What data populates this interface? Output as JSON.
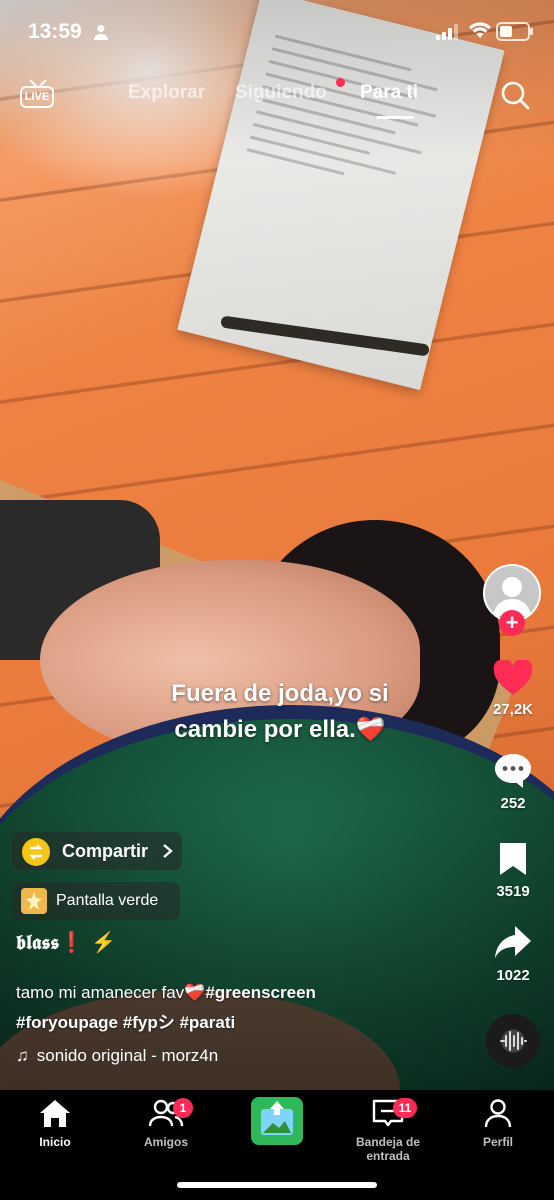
{
  "status_bar": {
    "time": "13:59"
  },
  "top_nav": {
    "live_label": "LIVE",
    "tabs": [
      {
        "label": "Explorar"
      },
      {
        "label": "Siguiendo"
      },
      {
        "label": "Para ti"
      }
    ]
  },
  "video": {
    "caption_line1": "Fuera de joda,yo si",
    "caption_line2": "cambie por ella.❤️‍🩹"
  },
  "actions": {
    "likes": "27,2K",
    "comments": "252",
    "saves": "3519",
    "shares": "1022"
  },
  "info": {
    "share_label": "Compartir",
    "effect_label": "Pantalla verde",
    "username": "𝖇𝖑𝖆𝖘𝖘❗️ ⚡️",
    "description_text": "tamo mi amanecer fav❤️‍🩹",
    "hashtag1": "#greenscreen",
    "hashtag2": "#foryoupage",
    "hashtag3": "#fypシ",
    "hashtag4": "#parati",
    "sound": "sonido original - morz4n"
  },
  "tab_bar": {
    "items": [
      {
        "label": "Inicio"
      },
      {
        "label": "Amigos",
        "badge": "1"
      },
      {
        "label": "Bandeja de entrada",
        "badge": "11"
      },
      {
        "label": "Perfil"
      }
    ]
  },
  "colors": {
    "accent": "#fe2c55",
    "like": "#ff2c55",
    "create": "#2fb85a"
  }
}
